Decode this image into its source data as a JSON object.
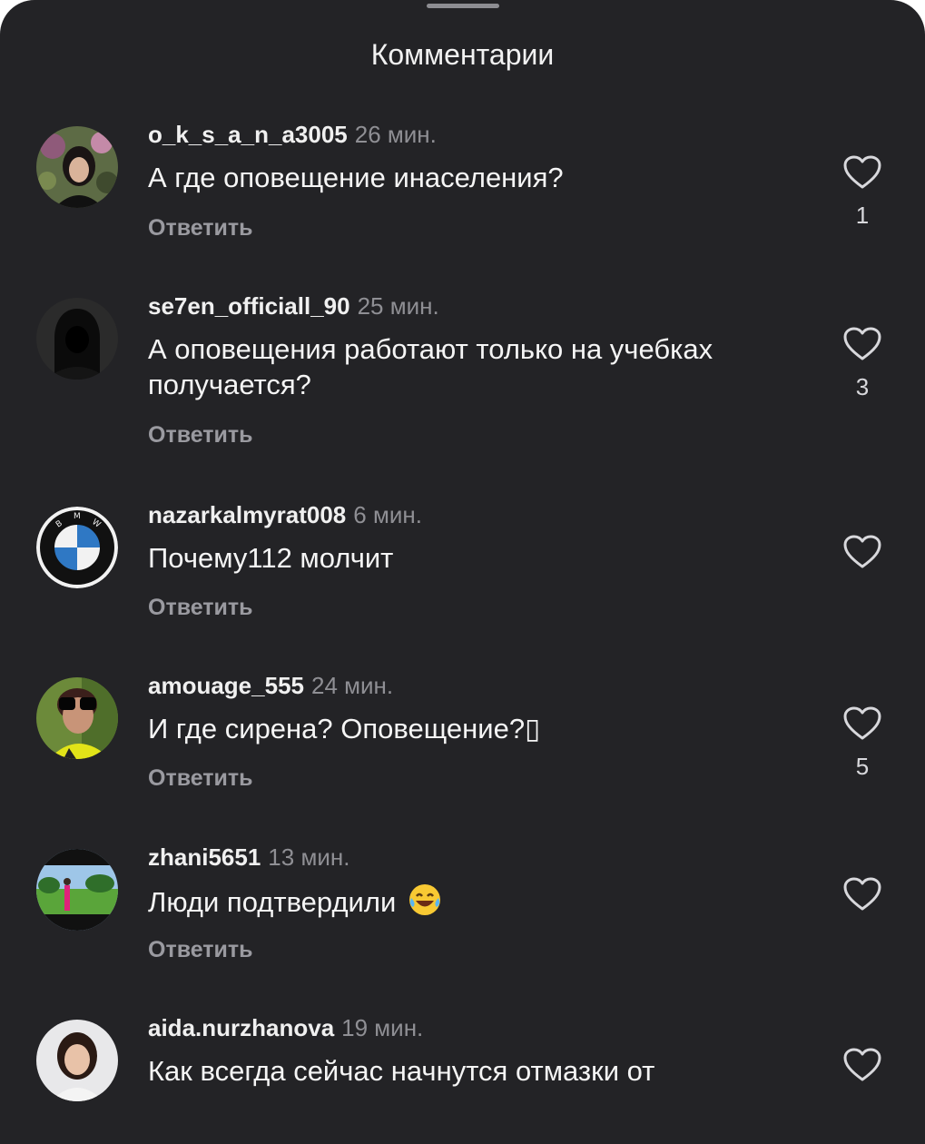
{
  "header": {
    "title": "Комментарии"
  },
  "comments": [
    {
      "username": "o_k_s_a_n_a3005",
      "time": "26 мин.",
      "text": "А где оповещение инаселения?",
      "reply_label": "Ответить",
      "likes": "1",
      "avatar_icon": "user-photo-avatar"
    },
    {
      "username": "se7en_officiall_90",
      "time": "25 мин.",
      "text": "А оповещения работают только на учебках получается?",
      "reply_label": "Ответить",
      "likes": "3",
      "avatar_icon": "hooded-figure-avatar"
    },
    {
      "username": "nazarkalmyrat008",
      "time": "6 мин.",
      "text": "Почему112 молчит",
      "reply_label": "Ответить",
      "likes": "",
      "avatar_icon": "bmw-logo-avatar"
    },
    {
      "username": "amouage_555",
      "time": "24 мин.",
      "text": "И где сирена? Оповещение?▯",
      "reply_label": "Ответить",
      "likes": "5",
      "avatar_icon": "sunglasses-avatar"
    },
    {
      "username": "zhani5651",
      "time": "13 мин.",
      "text": "Люди подтвердили",
      "emoji": "tears-of-joy-emoji",
      "reply_label": "Ответить",
      "likes": "",
      "avatar_icon": "park-photo-avatar"
    },
    {
      "username": "aida.nurzhanova",
      "time": "19 мин.",
      "text": "Как всегда сейчас начнутся отмазки от",
      "reply_label": "",
      "likes": "",
      "avatar_icon": "woman-portrait-avatar"
    }
  ],
  "colors": {
    "background": "#232326",
    "username": "#f0f0f0",
    "muted": "#8f8f94",
    "text": "#f5f5f5"
  }
}
